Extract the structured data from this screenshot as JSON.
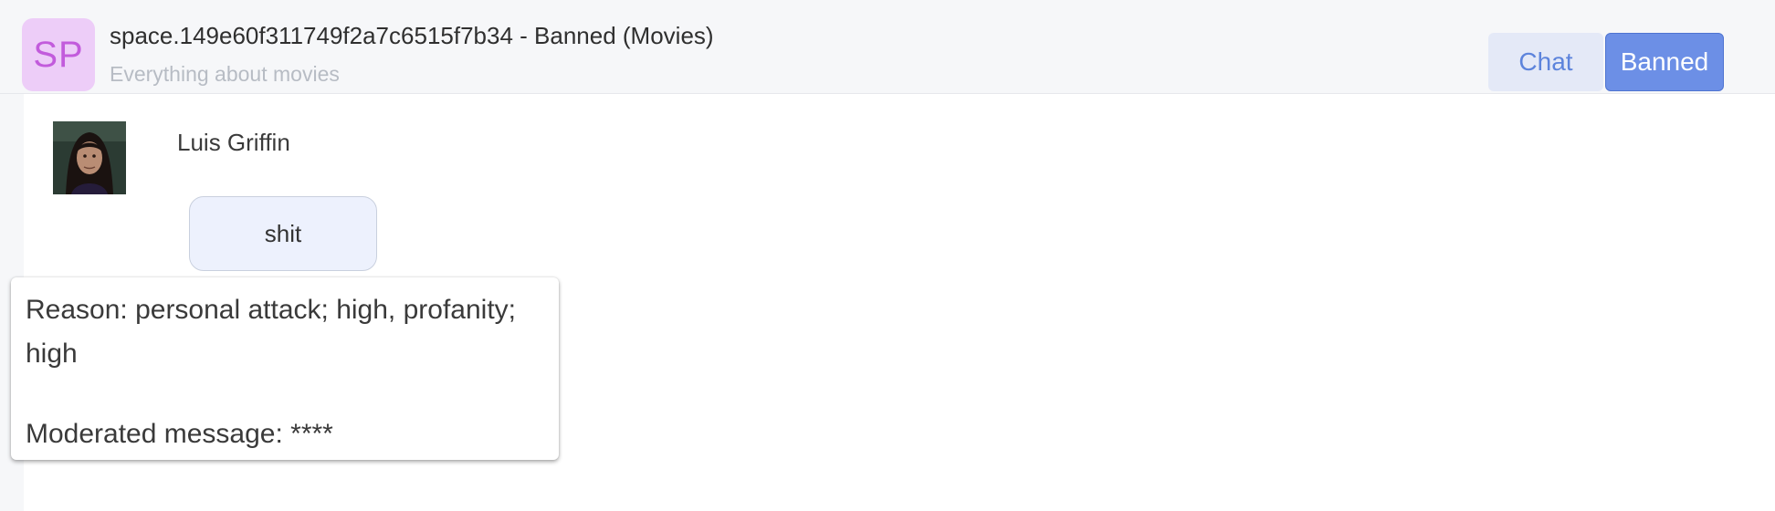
{
  "header": {
    "avatar_initials": "SP",
    "title": "space.149e60f311749f2a7c6515f7b34 - Banned (Movies)",
    "subtitle": "Everything about movies",
    "tabs": [
      {
        "label": "Chat",
        "active": false
      },
      {
        "label": "Banned",
        "active": true
      }
    ]
  },
  "message": {
    "user_name": "Luis Griffin",
    "text": "shit"
  },
  "moderation": {
    "reason": "Reason: personal attack; high, profanity; high",
    "moderated": "Moderated message: ****"
  },
  "colors": {
    "accent": "#6c8fe6",
    "avatar_bg": "#edcdf8",
    "avatar_text": "#c25bdc",
    "bubble_bg": "#edf1fd"
  }
}
